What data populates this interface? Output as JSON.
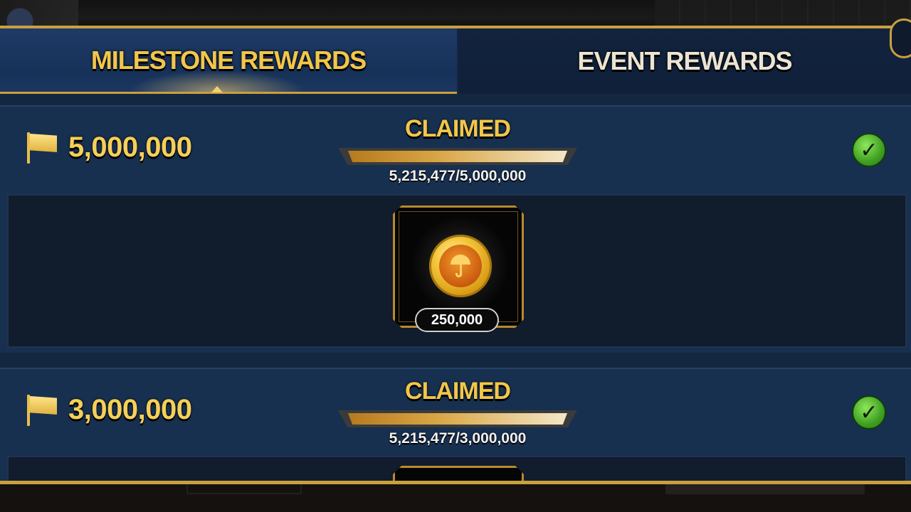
{
  "tabs": [
    {
      "label": "MILESTONE REWARDS",
      "active": true
    },
    {
      "label": "EVENT REWARDS",
      "active": false
    }
  ],
  "milestones": [
    {
      "goal": "5,000,000",
      "status": "CLAIMED",
      "progress_text": "5,215,477/5,000,000",
      "progress_fraction": 1.0,
      "reward": {
        "icon": "umbrella-coin-icon",
        "amount": "250,000"
      }
    },
    {
      "goal": "3,000,000",
      "status": "CLAIMED",
      "progress_text": "5,215,477/3,000,000",
      "progress_fraction": 1.0
    }
  ],
  "colors": {
    "accent_gold": "#c9a040",
    "panel_blue": "#142740",
    "active_tab_text": "#f2c64a",
    "check_green": "#3f9f22"
  }
}
